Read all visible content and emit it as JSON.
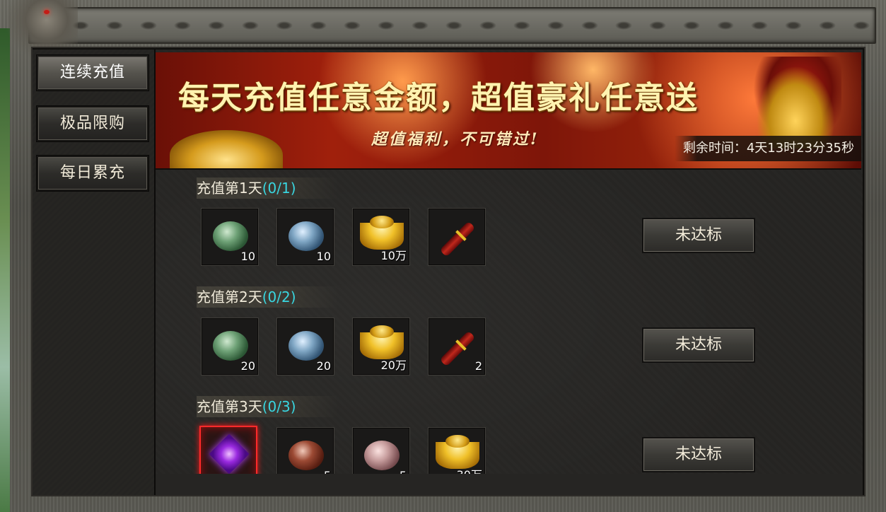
{
  "sidebar": {
    "items": [
      {
        "label": "连续充值",
        "active": true
      },
      {
        "label": "极品限购",
        "active": false
      },
      {
        "label": "每日累充",
        "active": false
      }
    ]
  },
  "banner": {
    "title": "每天充值任意金额，超值豪礼任意送",
    "subtitle": "超值福利，不可错过!",
    "timer": "剩余时间：4天13时23分35秒"
  },
  "rows": [
    {
      "title": "充值第1天",
      "progress": "(0/1)",
      "button": "未达标",
      "items": [
        {
          "icon": "green-gem-icon",
          "count": "10"
        },
        {
          "icon": "blue-gem-icon",
          "count": "10"
        },
        {
          "icon": "gold-ingot-icon",
          "count": "10万"
        },
        {
          "icon": "red-scroll-icon",
          "count": ""
        }
      ]
    },
    {
      "title": "充值第2天",
      "progress": "(0/2)",
      "button": "未达标",
      "items": [
        {
          "icon": "green-gem-icon",
          "count": "20"
        },
        {
          "icon": "blue-gem-icon",
          "count": "20"
        },
        {
          "icon": "gold-ingot-icon",
          "count": "20万"
        },
        {
          "icon": "red-scroll-icon",
          "count": "2"
        }
      ]
    },
    {
      "title": "充值第3天",
      "progress": "(0/3)",
      "button": "未达标",
      "items": [
        {
          "icon": "purple-crystal-icon",
          "count": ""
        },
        {
          "icon": "brown-gem-icon",
          "count": "5"
        },
        {
          "icon": "pink-gem-icon",
          "count": "5"
        },
        {
          "icon": "gold-ingot-icon",
          "count": "30万"
        }
      ]
    }
  ],
  "colors": {
    "progress": "#39d6e0",
    "special_border": "#ff2a2a"
  }
}
